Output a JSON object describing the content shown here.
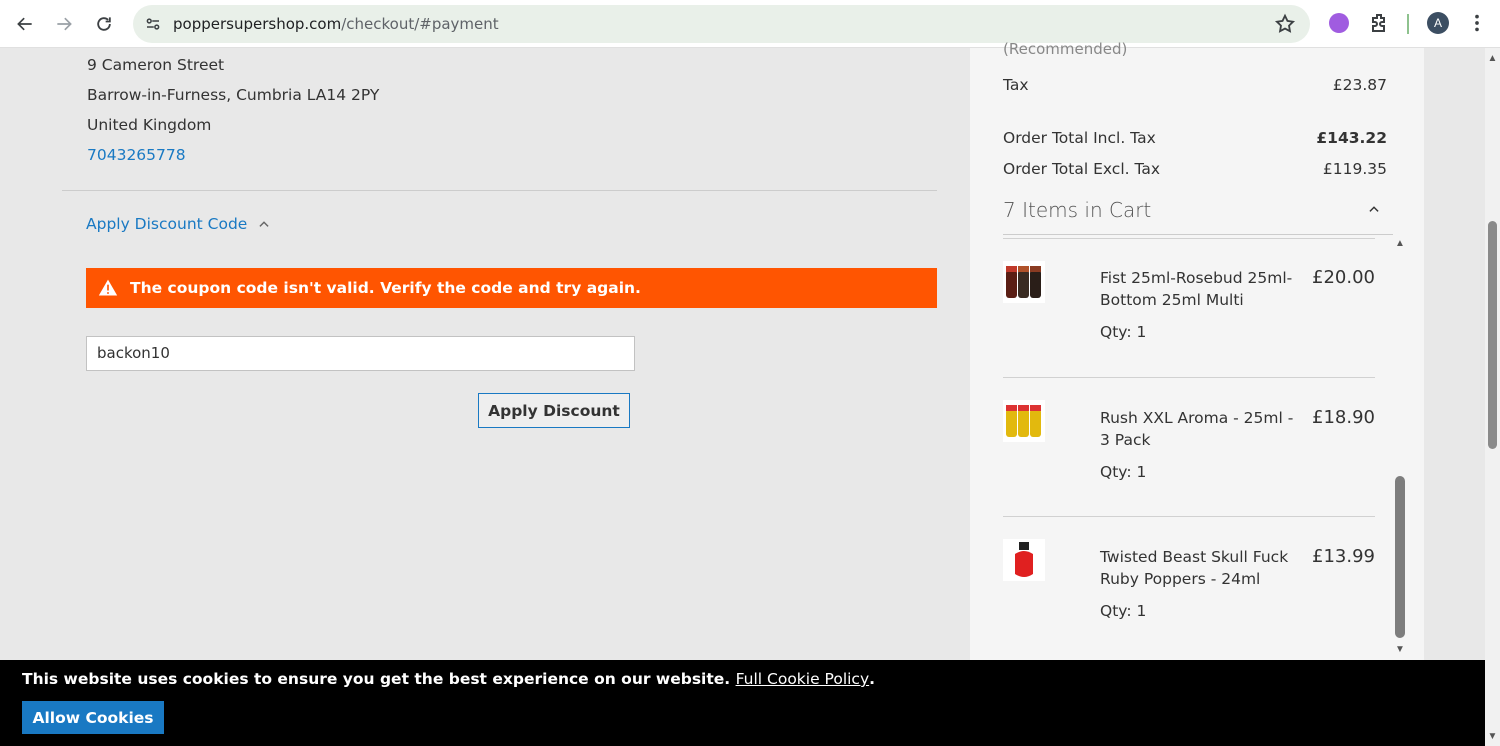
{
  "browser": {
    "url_domain": "poppersupershop.com",
    "url_path": "/checkout/#payment",
    "avatar_letter": "A"
  },
  "address": {
    "street": "9 Cameron Street",
    "city_line": "Barrow-in-Furness, Cumbria LA14 2PY",
    "country": "United Kingdom",
    "phone": "7043265778"
  },
  "discount": {
    "toggle_label": "Apply Discount Code",
    "error_message": "The coupon code isn't valid. Verify the code and try again.",
    "code_value": "backon10",
    "apply_label": "Apply Discount"
  },
  "summary": {
    "cut_label": "(Recommended)",
    "tax_label": "Tax",
    "tax_value": "£23.87",
    "total_incl_label": "Order Total Incl. Tax",
    "total_incl_value": "£143.22",
    "total_excl_label": "Order Total Excl. Tax",
    "total_excl_value": "£119.35",
    "cart_title": "7 Items in Cart",
    "items": [
      {
        "name": "Fist 25ml-Rosebud 25ml-Bottom 25ml Multi",
        "price": "£20.00",
        "qty": "Qty: 1"
      },
      {
        "name": "Rush XXL Aroma - 25ml - 3 Pack",
        "price": "£18.90",
        "qty": "Qty: 1"
      },
      {
        "name": "Twisted Beast Skull Fuck Ruby Poppers - 24ml",
        "price": "£13.99",
        "qty": "Qty: 1"
      }
    ]
  },
  "cookie": {
    "message": "This website uses cookies to ensure you get the best experience on our website.",
    "link": "Full Cookie Policy",
    "period": ".",
    "button": "Allow Cookies"
  },
  "colors": {
    "link": "#1979c3",
    "error": "#ff5501",
    "cookie_bg": "#000000"
  }
}
